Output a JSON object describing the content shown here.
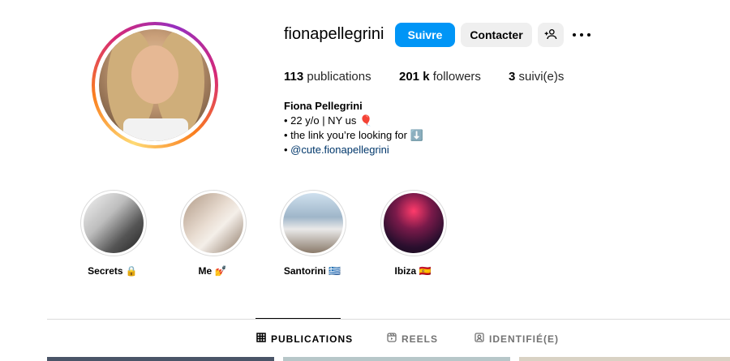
{
  "profile": {
    "username": "fionapellegrini",
    "follow_label": "Suivre",
    "contact_label": "Contacter"
  },
  "stats": [
    {
      "value": "113",
      "label": "publications"
    },
    {
      "value": "201 k",
      "label": "followers"
    },
    {
      "value": "3",
      "label": "suivi(e)s"
    }
  ],
  "bio": {
    "name": "Fiona Pellegrini",
    "line1": "• 22 y/o | NY us 🎈",
    "line2": "• the link you’re looking for ⬇️",
    "line3_prefix": "• ",
    "link": "@cute.fionapellegrini"
  },
  "highlights": [
    {
      "label": "Secrets 🔒"
    },
    {
      "label": "Me 💅"
    },
    {
      "label": "Santorini 🇬🇷"
    },
    {
      "label": "Ibiza 🇪🇸"
    }
  ],
  "tabs": [
    {
      "label": "PUBLICATIONS",
      "active": true
    },
    {
      "label": "REELS",
      "active": false
    },
    {
      "label": "IDENTIFIÉ(E)",
      "active": false
    }
  ],
  "colors": {
    "accent": "#0095f6",
    "button_bg": "#efefef",
    "link": "#00376b",
    "ring_start": "#feda75",
    "ring_mid": "#d62976",
    "ring_end": "#962fbf"
  }
}
